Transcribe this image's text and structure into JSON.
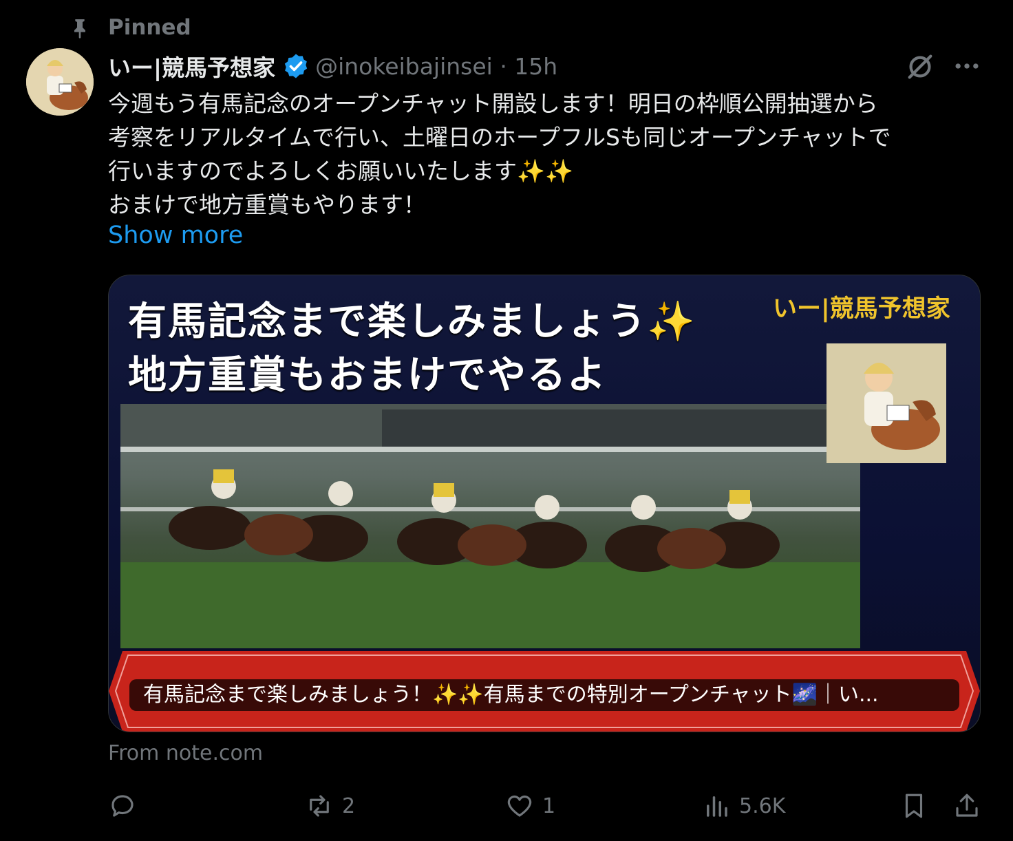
{
  "pinned_label": "Pinned",
  "author": {
    "name": "いー|競馬予想家",
    "handle_time": "@inokeibajinsei · 15h"
  },
  "tweet": {
    "lines": [
      "今週もう有馬記念のオープンチャット開設します！明日の枠順公開抽選から",
      "考察をリアルタイムで行い、土曜日のホープフルSも同じオープンチャットで",
      "行いますのでよろしくお願いいたします✨✨",
      "おまけで地方重賞もやります！"
    ],
    "show_more": "Show more"
  },
  "card": {
    "title_line1": "有馬記念まで楽しみましょう✨",
    "title_line2": "地方重賞もおまけでやるよ",
    "brand": "いー|競馬予想家",
    "caption": "有馬記念まで楽しみましょう！✨✨有馬までの特別オープンチャット🌌｜い...",
    "source": "From note.com"
  },
  "actions": {
    "reply_count": "",
    "retweet_count": "2",
    "like_count": "1",
    "views_count": "5.6K"
  },
  "colors": {
    "background": "#000000",
    "text": "#e7e9ea",
    "muted": "#71767b",
    "link": "#1d9bf0",
    "verified": "#1d9bf0",
    "banner_red": "#c8241b"
  },
  "icons": [
    "pin-icon",
    "verified-badge-icon",
    "grok-icon",
    "more-icon",
    "reply-icon",
    "retweet-icon",
    "like-icon",
    "views-icon",
    "bookmark-icon",
    "share-icon"
  ]
}
